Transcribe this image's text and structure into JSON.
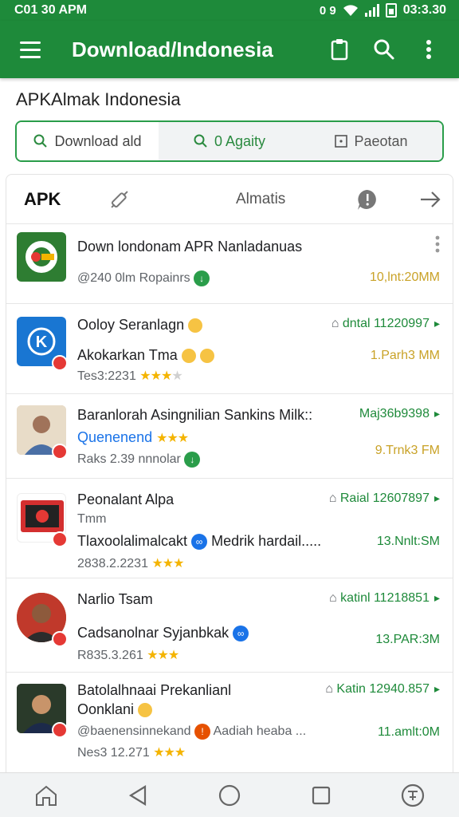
{
  "status": {
    "time": "C01 30 APM",
    "right_text": "0 9",
    "clock": "03:3.30"
  },
  "appbar": {
    "title": "Download/Indonesia",
    "menu_icon": "hamburger-icon",
    "clipboard_icon": "clipboard-icon",
    "search_icon": "search-icon",
    "more_icon": "more-vertical-icon"
  },
  "section": {
    "title": "APKAlmak Indonesia"
  },
  "search_tabs": [
    {
      "label": "Download ald",
      "icon": "search-icon"
    },
    {
      "label": "0 Agaity",
      "icon": "search-icon"
    },
    {
      "label": "Paeotan",
      "icon": "square-icon"
    }
  ],
  "card_tabs": {
    "first": "APK",
    "second": "Almatis"
  },
  "apps": [
    {
      "title": "Down londonam APR Nanladanuas",
      "sub": "@240 0lm Ropainrs",
      "right": "10,lnt:20MM",
      "right_color": "orange"
    },
    {
      "title": "Ooloy Seranlagn",
      "sub": "Akokarkan Tma",
      "meta": "Tes3:2231",
      "right_top": "dntal 11220997",
      "right": "1.Parh3 MM"
    },
    {
      "title": "Baranlorah Asingnilian Sankins Milk::",
      "sub": "Quenenend",
      "meta": "Raks 2.39 nnnolar",
      "right_top": "Maj36b9398",
      "right": "9.Trnk3 FM"
    },
    {
      "title": "Peonalant Alpa",
      "sub": "Tmm",
      "third": "Tlaxoolalimalcakt",
      "third_b": "Medrik hardail.....",
      "meta": "2838.2.2231",
      "right_top": "Raial 12607897",
      "right": "13.Nnlt:SM"
    },
    {
      "title": "Narlio Tsam",
      "sub": "Cadsanolnar Syjanbkak",
      "meta": "R835.3.261",
      "right_top": "katinl 11218851",
      "right": "13.PAR:3M"
    },
    {
      "title": "Batolalhnaai Prekanlianl",
      "sub": "Oonklani",
      "third": "@baenensinnekand",
      "third_b": "Aadiah heaba ...",
      "meta": "Nes3 12.271",
      "right_top": "Katin 12940.857",
      "right": "11.amlt:0M"
    }
  ]
}
